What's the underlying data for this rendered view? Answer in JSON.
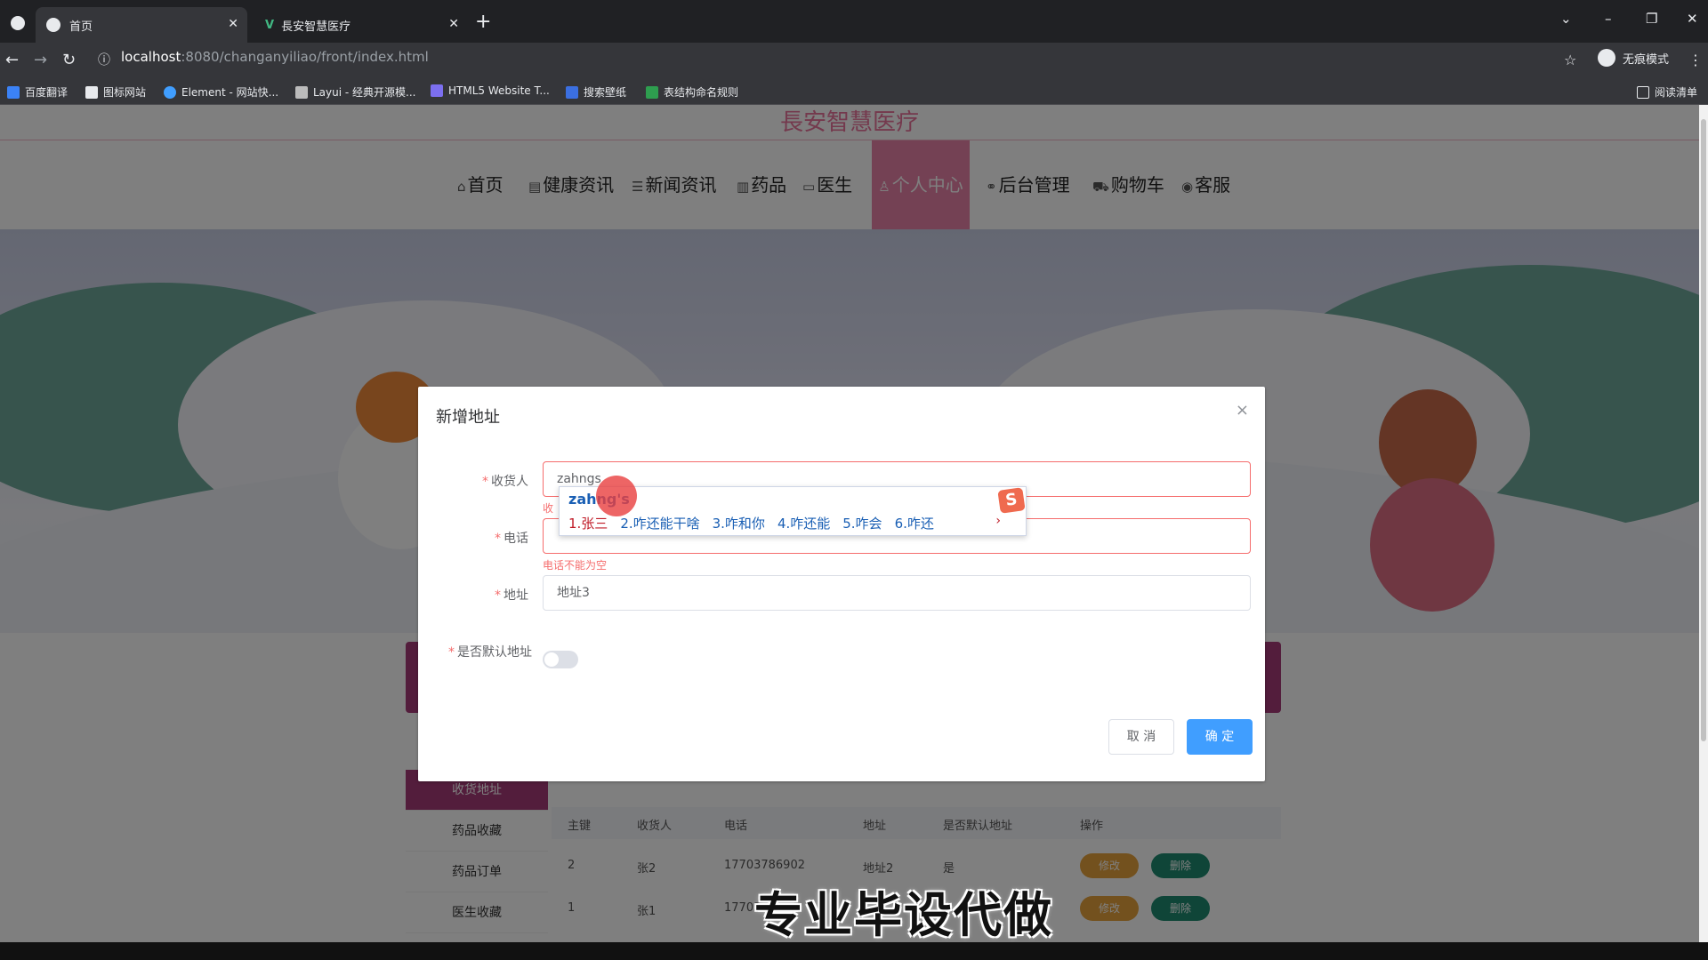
{
  "browser": {
    "tabs": [
      {
        "label": "首页",
        "active": true
      },
      {
        "label": "長安智慧医疗",
        "active": false
      }
    ],
    "new_tab": "+",
    "url_host": "localhost",
    "url_path": ":8080/changanyiliao/front/index.html",
    "incognito_label": "无痕模式",
    "reading_list": "阅读清单",
    "bookmarks": [
      "百度翻译",
      "图标网站",
      "Element - 网站快...",
      "Layui - 经典开源模...",
      "HTML5 Website T...",
      "搜索壁纸",
      "表结构命名规则"
    ]
  },
  "site": {
    "title": "長安智慧医疗",
    "nav": [
      {
        "label": "首页",
        "icon": "home-icon",
        "glyph": "⌂"
      },
      {
        "label": "健康资讯",
        "icon": "doc-icon",
        "glyph": "▤"
      },
      {
        "label": "新闻资讯",
        "icon": "news-icon",
        "glyph": "☰"
      },
      {
        "label": "药品",
        "icon": "book-icon",
        "glyph": "▥"
      },
      {
        "label": "医生",
        "icon": "reader-icon",
        "glyph": "▭"
      },
      {
        "label": "个人中心",
        "icon": "user-icon",
        "glyph": "♙",
        "active": true
      },
      {
        "label": "后台管理",
        "icon": "link-icon",
        "glyph": "⚭"
      },
      {
        "label": "购物车",
        "icon": "cart-icon",
        "glyph": "⛟"
      },
      {
        "label": "客服",
        "icon": "service-icon",
        "glyph": "◉"
      }
    ]
  },
  "sidebar": {
    "items": [
      "收货地址",
      "药品收藏",
      "药品订单",
      "医生收藏"
    ]
  },
  "table": {
    "headers": [
      "主键",
      "收货人",
      "电话",
      "地址",
      "是否默认地址",
      "操作"
    ],
    "rows": [
      {
        "id": "2",
        "name": "张2",
        "phone": "17703786902",
        "address": "地址2",
        "default": "是"
      },
      {
        "id": "1",
        "name": "张1",
        "phone": "17703",
        "address": "",
        "default": ""
      }
    ],
    "edit_label": "修改",
    "delete_label": "删除"
  },
  "dialog": {
    "title": "新增地址",
    "close": "×",
    "fields": {
      "receiver_label": "收货人",
      "receiver_value": "zahngs",
      "receiver_error": "收",
      "phone_label": "电话",
      "phone_value": "",
      "phone_error": "电话不能为空",
      "address_label": "地址",
      "address_value": "地址3",
      "default_label": "是否默认地址",
      "default_on": false
    },
    "cancel": "取 消",
    "confirm": "确 定"
  },
  "ime": {
    "composition": "zahng's",
    "candidates": [
      "1.张三",
      "2.咋还能干啥",
      "3.咋和你",
      "4.咋还能",
      "5.咋会",
      "6.咋还"
    ],
    "logo": "S",
    "next": "›"
  },
  "watermark": "专业毕设代做",
  "colors": {
    "brand_pink": "#e882a8",
    "primary_blue": "#409eff",
    "error_red": "#f56c6c",
    "edit_orange": "#e6a23c",
    "delete_green": "#1f8a70"
  }
}
